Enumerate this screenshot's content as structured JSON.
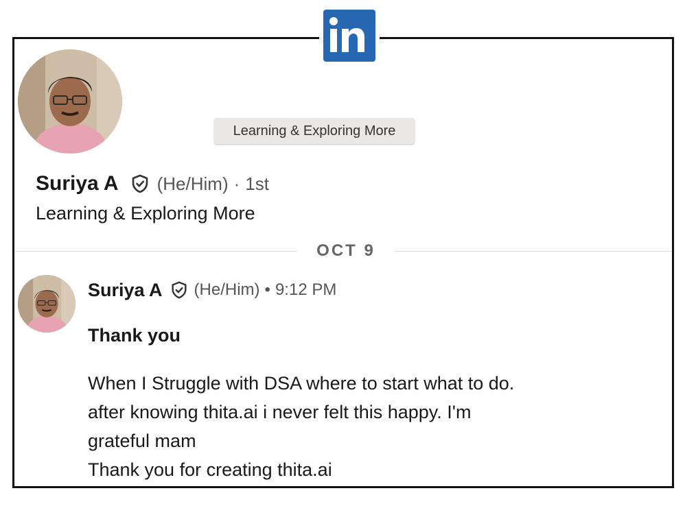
{
  "brand": {
    "logo_text": "in",
    "color": "#2867b2"
  },
  "tooltip": {
    "text": "Learning & Exploring More"
  },
  "profile": {
    "name": "Suriya A",
    "pronouns": "(He/Him)",
    "separator": "·",
    "connection_degree": "1st",
    "headline": "Learning & Exploring More",
    "verified_icon": "shield-check-icon"
  },
  "date_separator": {
    "label": "OCT 9"
  },
  "message": {
    "sender": "Suriya A",
    "pronouns": "(He/Him)",
    "separator": "•",
    "time": "9:12 PM",
    "title": "Thank you",
    "lines": [
      "When I Struggle with DSA where to start what to do.",
      "after knowing thita.ai i never felt this happy. I'm",
      "grateful mam",
      "Thank you for creating thita.ai"
    ]
  }
}
